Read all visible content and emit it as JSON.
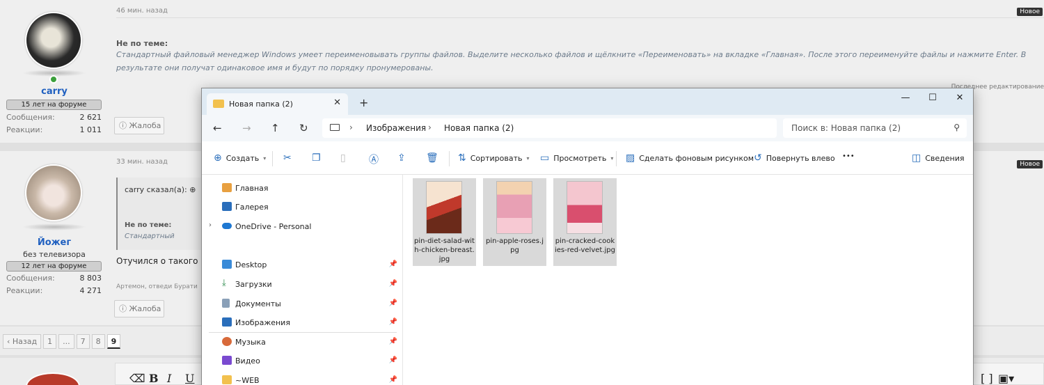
{
  "forum": {
    "post1": {
      "time": "46 мин. назад",
      "badge": "Новое",
      "username": "carry",
      "banner": "15 лет на форуме",
      "messages_label": "Сообщения:",
      "messages": "2 621",
      "reactions_label": "Реакции:",
      "reactions": "1 011",
      "offtopic_label": "Не по теме:",
      "offtopic_text": "Стандартный файловый менеджер Windows умеет переименовывать группы файлов. Выделите несколько файлов и щёлкните «Переименовать» на вкладке «Главная». После этого переименуйте файлы и нажмите Enter. В результате они получат одинаковое имя и будут по порядку пронумерованы.",
      "edited": "Последнее редактирование",
      "report": "Жалоба"
    },
    "post2": {
      "time": "33 мин. назад",
      "badge": "Новое",
      "username": "Йожег",
      "user_title": "без телевизора",
      "banner": "12 лет на форуме",
      "messages_label": "Сообщения:",
      "messages": "8 803",
      "reactions_label": "Реакции:",
      "reactions": "4 271",
      "quote_author": "carry сказал(а):",
      "quote_label": "Не по теме:",
      "quote_text": "Стандартный",
      "body": "Отучился о такого по",
      "signature": "Артемон, отведи Бурати",
      "report": "Жалоба"
    },
    "pager": {
      "prev": "‹ Назад",
      "pages": [
        "1",
        "...",
        "7",
        "8",
        "9"
      ],
      "current": "9"
    },
    "editor": {
      "buttons": [
        "⌫",
        "B",
        "I",
        "U"
      ]
    }
  },
  "explorer": {
    "tab_title": "Новая папка (2)",
    "window_controls": {
      "minimize": "—",
      "maximize": "☐",
      "close": "✕"
    },
    "breadcrumb": [
      "Изображения",
      "Новая папка (2)"
    ],
    "search_placeholder": "Поиск в: Новая папка (2)",
    "toolbar": {
      "create": "Создать",
      "sort": "Сортировать",
      "view": "Просмотреть",
      "set_background": "Сделать фоновым рисунком",
      "rotate_left": "Повернуть влево",
      "more": "•••",
      "details": "Сведения"
    },
    "nav": {
      "home": "Главная",
      "gallery": "Галерея",
      "onedrive": "OneDrive - Personal",
      "desktop": "Desktop",
      "downloads": "Загрузки",
      "documents": "Документы",
      "pictures": "Изображения",
      "music": "Музыка",
      "video": "Видео",
      "web": "~WEB"
    },
    "files": [
      {
        "name": "pin-diet-salad-with-chicken-breast.jpg",
        "color": "#c0392b"
      },
      {
        "name": "pin-apple-roses.jpg",
        "color": "#e8a0b4"
      },
      {
        "name": "pin-cracked-cookies-red-velvet.jpg",
        "color": "#d94f6e"
      }
    ]
  }
}
